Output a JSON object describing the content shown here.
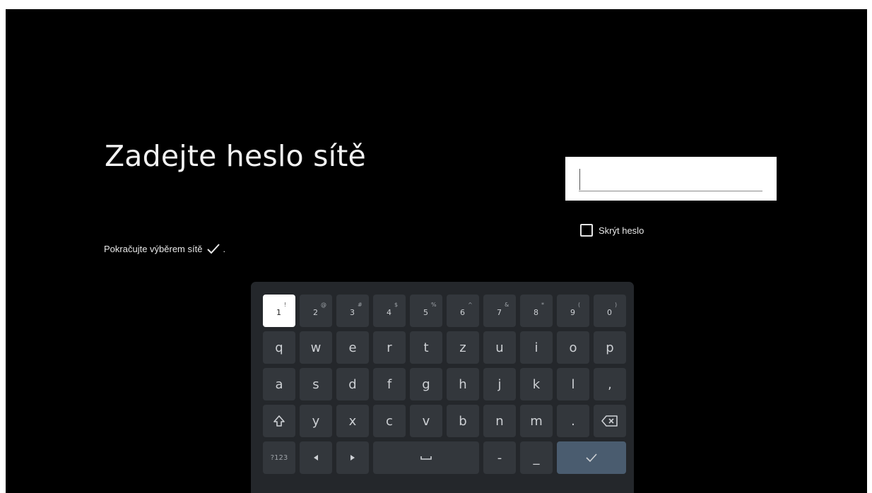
{
  "page": {
    "title": "Zadejte heslo sítě",
    "hint_text": "Pokračujte výběrem sítě",
    "hint_suffix": ".",
    "hint_icon": "checkmark-icon"
  },
  "password_field": {
    "value": "",
    "placeholder": ""
  },
  "hide_password": {
    "label": "Skrýt heslo",
    "checked": false
  },
  "keyboard": {
    "row1": [
      {
        "main": "1",
        "sup": "!"
      },
      {
        "main": "2",
        "sup": "@"
      },
      {
        "main": "3",
        "sup": "#"
      },
      {
        "main": "4",
        "sup": "$"
      },
      {
        "main": "5",
        "sup": "%"
      },
      {
        "main": "6",
        "sup": "^"
      },
      {
        "main": "7",
        "sup": "&"
      },
      {
        "main": "8",
        "sup": "*"
      },
      {
        "main": "9",
        "sup": "("
      },
      {
        "main": "0",
        "sup": ")"
      }
    ],
    "row2": [
      "q",
      "w",
      "e",
      "r",
      "t",
      "z",
      "u",
      "i",
      "o",
      "p"
    ],
    "row3": [
      "a",
      "s",
      "d",
      "f",
      "g",
      "h",
      "j",
      "k",
      "l",
      ","
    ],
    "row4_letters": [
      "y",
      "x",
      "c",
      "v",
      "b",
      "n",
      "m",
      "."
    ],
    "row4_icons": {
      "shift": "shift-icon",
      "backspace": "backspace-icon"
    },
    "row5": {
      "symbols_label": "?123",
      "dash": "-",
      "underscore": "_",
      "icons": {
        "left": "arrow-left-icon",
        "right": "arrow-right-icon",
        "space": "space-icon",
        "enter": "checkmark-icon"
      }
    },
    "focused_key": "1",
    "colors": {
      "panel": "#24272b",
      "key": "#33373c",
      "focused_key": "#ffffff",
      "enter_key": "#4a5c6f"
    }
  }
}
